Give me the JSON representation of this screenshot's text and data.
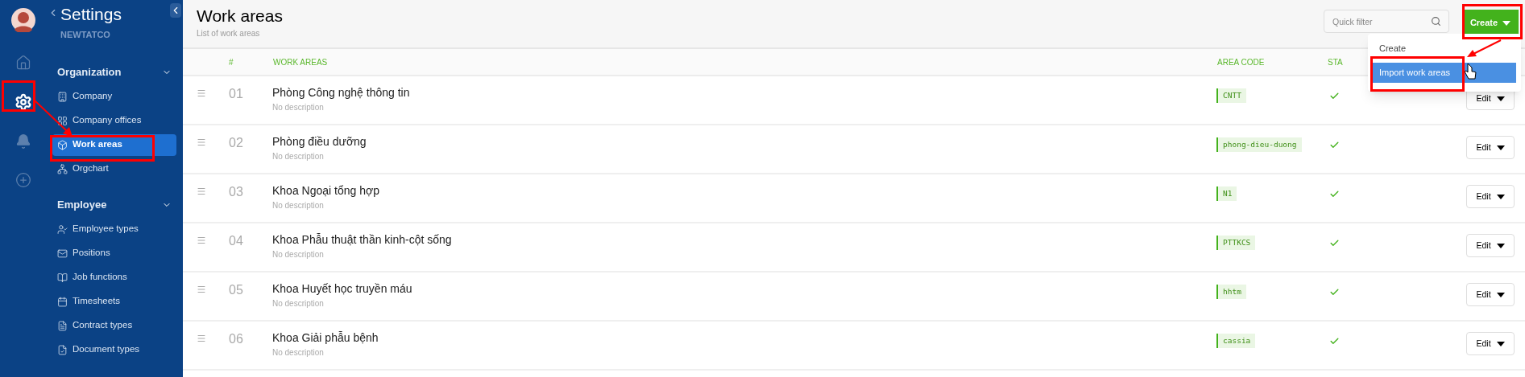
{
  "rail": [
    {
      "kind": "avatar"
    },
    {
      "kind": "home",
      "selected": false
    },
    {
      "kind": "settings",
      "selected": true
    },
    {
      "kind": "bell",
      "selected": false
    },
    {
      "kind": "add",
      "selected": false
    }
  ],
  "settings_panel": {
    "title": "Settings",
    "subtitle": "NEWTATCO",
    "sections": [
      {
        "title": "Organization",
        "expanded": true,
        "items": [
          {
            "label": "Company",
            "selected": false
          },
          {
            "label": "Company offices",
            "selected": false
          },
          {
            "label": "Work areas",
            "selected": true
          },
          {
            "label": "Orgchart",
            "selected": false
          }
        ]
      },
      {
        "title": "Employee",
        "expanded": true,
        "items": [
          {
            "label": "Employee types",
            "selected": false
          },
          {
            "label": "Positions",
            "selected": false
          },
          {
            "label": "Job functions",
            "selected": false
          },
          {
            "label": "Timesheets",
            "selected": false
          },
          {
            "label": "Contract types",
            "selected": false
          },
          {
            "label": "Document types",
            "selected": false
          }
        ]
      }
    ]
  },
  "page": {
    "title": "Work areas",
    "subtitle": "List of work areas",
    "filter": {
      "placeholder": "Quick filter"
    },
    "create_button": "Create",
    "create_menu": [
      {
        "label": "Create",
        "selected": false
      },
      {
        "label": "Import work areas",
        "selected": true
      }
    ]
  },
  "table": {
    "columns": [
      "#",
      "WORK AREAS",
      "AREA CODE",
      "STA"
    ],
    "rows": [
      {
        "number": "01",
        "name": "Phòng Công nghệ thông tin",
        "description": "No description",
        "code": "CNTT",
        "active": true,
        "action": "Edit"
      },
      {
        "number": "02",
        "name": "Phòng điều dưỡng",
        "description": "No description",
        "code": "phong-dieu-duong",
        "active": true,
        "action": "Edit"
      },
      {
        "number": "03",
        "name": "Khoa Ngoại tổng hợp",
        "description": "No description",
        "code": "N1",
        "active": true,
        "action": "Edit"
      },
      {
        "number": "04",
        "name": "Khoa Phẫu thuật thần kinh-cột sống",
        "description": "No description",
        "code": "PTTKCS",
        "active": true,
        "action": "Edit"
      },
      {
        "number": "05",
        "name": "Khoa Huyết học truyền máu",
        "description": "No description",
        "code": "hhtm",
        "active": true,
        "action": "Edit"
      },
      {
        "number": "06",
        "name": "Khoa Giải phẫu bệnh",
        "description": "No description",
        "code": "cassia",
        "active": true,
        "action": "Edit"
      }
    ]
  }
}
